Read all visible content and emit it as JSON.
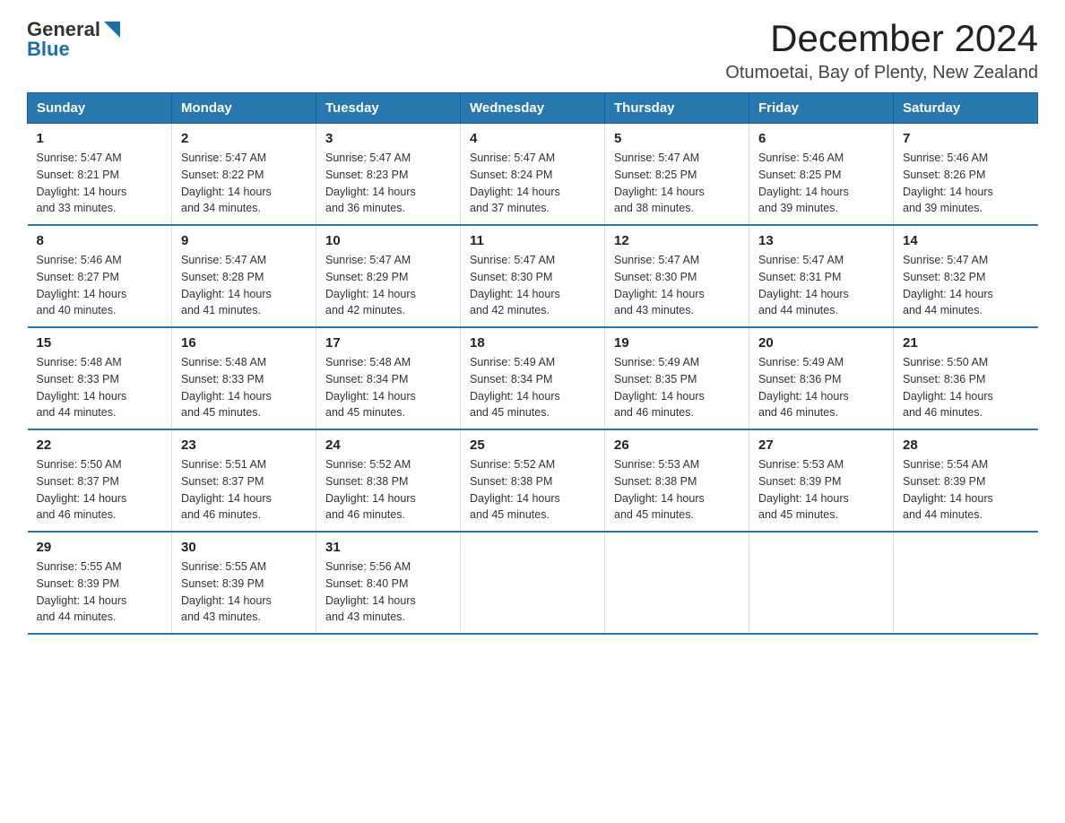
{
  "logo": {
    "text_general": "General",
    "text_blue": "Blue"
  },
  "header": {
    "month_year": "December 2024",
    "location": "Otumoetai, Bay of Plenty, New Zealand"
  },
  "days_of_week": [
    "Sunday",
    "Monday",
    "Tuesday",
    "Wednesday",
    "Thursday",
    "Friday",
    "Saturday"
  ],
  "weeks": [
    [
      {
        "day": "1",
        "sunrise": "5:47 AM",
        "sunset": "8:21 PM",
        "daylight": "14 hours and 33 minutes."
      },
      {
        "day": "2",
        "sunrise": "5:47 AM",
        "sunset": "8:22 PM",
        "daylight": "14 hours and 34 minutes."
      },
      {
        "day": "3",
        "sunrise": "5:47 AM",
        "sunset": "8:23 PM",
        "daylight": "14 hours and 36 minutes."
      },
      {
        "day": "4",
        "sunrise": "5:47 AM",
        "sunset": "8:24 PM",
        "daylight": "14 hours and 37 minutes."
      },
      {
        "day": "5",
        "sunrise": "5:47 AM",
        "sunset": "8:25 PM",
        "daylight": "14 hours and 38 minutes."
      },
      {
        "day": "6",
        "sunrise": "5:46 AM",
        "sunset": "8:25 PM",
        "daylight": "14 hours and 39 minutes."
      },
      {
        "day": "7",
        "sunrise": "5:46 AM",
        "sunset": "8:26 PM",
        "daylight": "14 hours and 39 minutes."
      }
    ],
    [
      {
        "day": "8",
        "sunrise": "5:46 AM",
        "sunset": "8:27 PM",
        "daylight": "14 hours and 40 minutes."
      },
      {
        "day": "9",
        "sunrise": "5:47 AM",
        "sunset": "8:28 PM",
        "daylight": "14 hours and 41 minutes."
      },
      {
        "day": "10",
        "sunrise": "5:47 AM",
        "sunset": "8:29 PM",
        "daylight": "14 hours and 42 minutes."
      },
      {
        "day": "11",
        "sunrise": "5:47 AM",
        "sunset": "8:30 PM",
        "daylight": "14 hours and 42 minutes."
      },
      {
        "day": "12",
        "sunrise": "5:47 AM",
        "sunset": "8:30 PM",
        "daylight": "14 hours and 43 minutes."
      },
      {
        "day": "13",
        "sunrise": "5:47 AM",
        "sunset": "8:31 PM",
        "daylight": "14 hours and 44 minutes."
      },
      {
        "day": "14",
        "sunrise": "5:47 AM",
        "sunset": "8:32 PM",
        "daylight": "14 hours and 44 minutes."
      }
    ],
    [
      {
        "day": "15",
        "sunrise": "5:48 AM",
        "sunset": "8:33 PM",
        "daylight": "14 hours and 44 minutes."
      },
      {
        "day": "16",
        "sunrise": "5:48 AM",
        "sunset": "8:33 PM",
        "daylight": "14 hours and 45 minutes."
      },
      {
        "day": "17",
        "sunrise": "5:48 AM",
        "sunset": "8:34 PM",
        "daylight": "14 hours and 45 minutes."
      },
      {
        "day": "18",
        "sunrise": "5:49 AM",
        "sunset": "8:34 PM",
        "daylight": "14 hours and 45 minutes."
      },
      {
        "day": "19",
        "sunrise": "5:49 AM",
        "sunset": "8:35 PM",
        "daylight": "14 hours and 46 minutes."
      },
      {
        "day": "20",
        "sunrise": "5:49 AM",
        "sunset": "8:36 PM",
        "daylight": "14 hours and 46 minutes."
      },
      {
        "day": "21",
        "sunrise": "5:50 AM",
        "sunset": "8:36 PM",
        "daylight": "14 hours and 46 minutes."
      }
    ],
    [
      {
        "day": "22",
        "sunrise": "5:50 AM",
        "sunset": "8:37 PM",
        "daylight": "14 hours and 46 minutes."
      },
      {
        "day": "23",
        "sunrise": "5:51 AM",
        "sunset": "8:37 PM",
        "daylight": "14 hours and 46 minutes."
      },
      {
        "day": "24",
        "sunrise": "5:52 AM",
        "sunset": "8:38 PM",
        "daylight": "14 hours and 46 minutes."
      },
      {
        "day": "25",
        "sunrise": "5:52 AM",
        "sunset": "8:38 PM",
        "daylight": "14 hours and 45 minutes."
      },
      {
        "day": "26",
        "sunrise": "5:53 AM",
        "sunset": "8:38 PM",
        "daylight": "14 hours and 45 minutes."
      },
      {
        "day": "27",
        "sunrise": "5:53 AM",
        "sunset": "8:39 PM",
        "daylight": "14 hours and 45 minutes."
      },
      {
        "day": "28",
        "sunrise": "5:54 AM",
        "sunset": "8:39 PM",
        "daylight": "14 hours and 44 minutes."
      }
    ],
    [
      {
        "day": "29",
        "sunrise": "5:55 AM",
        "sunset": "8:39 PM",
        "daylight": "14 hours and 44 minutes."
      },
      {
        "day": "30",
        "sunrise": "5:55 AM",
        "sunset": "8:39 PM",
        "daylight": "14 hours and 43 minutes."
      },
      {
        "day": "31",
        "sunrise": "5:56 AM",
        "sunset": "8:40 PM",
        "daylight": "14 hours and 43 minutes."
      },
      null,
      null,
      null,
      null
    ]
  ],
  "labels": {
    "sunrise": "Sunrise:",
    "sunset": "Sunset:",
    "daylight": "Daylight:"
  }
}
